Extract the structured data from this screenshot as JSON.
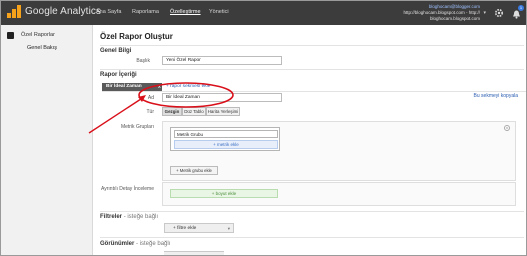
{
  "header": {
    "logo_text": "Google Analytics",
    "nav": [
      "Ana Sayfa",
      "Raporlama",
      "Özelleştirme",
      "Yönetici"
    ],
    "account_name": "bloghocam@blogger.com",
    "account_url": "http://bloghocam.blogspot.com - http://",
    "account_url2": "bloghocam.blogspot.com",
    "notification_count": "1",
    "icons": [
      "gear-icon",
      "bell-icon"
    ]
  },
  "sidebar": {
    "section_label": "Özel Raporlar",
    "item_label": "Genel Bakış"
  },
  "main": {
    "page_title": "Özel Rapor Oluştur",
    "general_info": {
      "heading": "Genel Bilgi",
      "title_label": "Başlık",
      "title_value": "Yeni Özel Rapor"
    },
    "content": {
      "heading": "Rapor İçeriği",
      "tab_label": "Bir İdeal Zaman",
      "tab_close": "x",
      "add_tab": "+ rapor sekmesi ekle",
      "copy_link": "Bu sekmeyi kopyala",
      "name_label": "Ad",
      "name_value": "Bir İdeal Zaman",
      "type_label": "Tür",
      "types": [
        "Gezgin",
        "Düz Tablo",
        "Harita Yerleşimi"
      ],
      "metric_groups_label": "Metrik Grupları",
      "metric_group_name": "Metrik Grubu",
      "add_metric": "+ metrik ekle",
      "add_metric_group": "+ Metrik grubu ekle",
      "detail_label": "Ayrıntılı Detay İnceleme",
      "add_dimension": "+ boyut ekle",
      "remove_symbol": "x"
    },
    "filters": {
      "heading": "Filtreler",
      "optional": "- isteğe bağlı",
      "add_filter": "+ filtre ekle",
      "caret": "▾"
    },
    "views": {
      "heading": "Görünümler",
      "optional": "- isteğe bağlı"
    }
  }
}
